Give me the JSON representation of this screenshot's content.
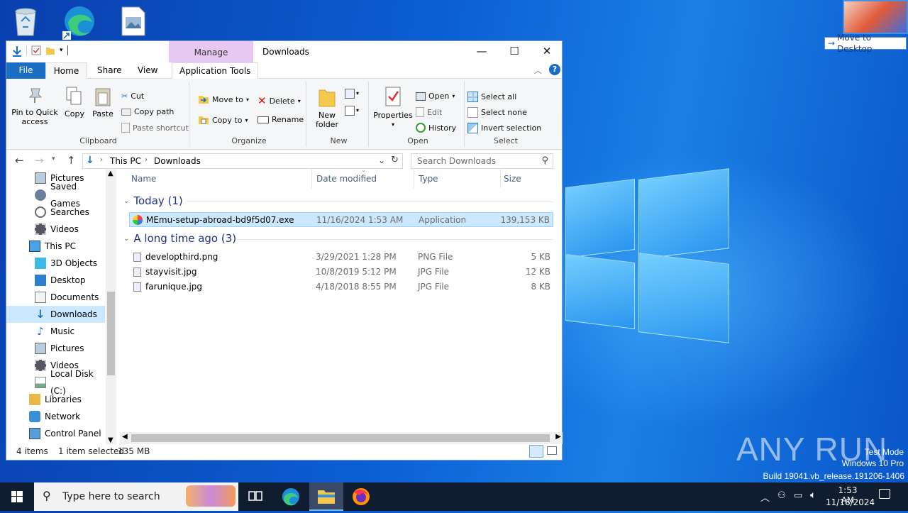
{
  "desktop": {
    "move_to_desktop": "Move to Desktop",
    "icons": [
      "recycle-bin-icon",
      "edge-shortcut-icon",
      "image-file-icon"
    ],
    "watermark": {
      "brand": "ANY RUN",
      "line1": "Test Mode",
      "line2": "Windows 10 Pro",
      "line3": "Build 19041.vb_release.191206-1406"
    }
  },
  "explorer": {
    "title": "Downloads",
    "context_tab": "Manage",
    "tabs": {
      "file": "File",
      "home": "Home",
      "share": "Share",
      "view": "View",
      "app_tools": "Application Tools"
    },
    "ribbon": {
      "clipboard": {
        "label": "Clipboard",
        "pin": "Pin to Quick access",
        "copy": "Copy",
        "paste": "Paste",
        "cut": "Cut",
        "copy_path": "Copy path",
        "paste_shortcut": "Paste shortcut"
      },
      "organize": {
        "label": "Organize",
        "move_to": "Move to",
        "copy_to": "Copy to",
        "delete": "Delete",
        "rename": "Rename"
      },
      "new": {
        "label": "New",
        "new_folder": "New folder"
      },
      "open": {
        "label": "Open",
        "properties": "Properties",
        "open": "Open",
        "edit": "Edit",
        "history": "History"
      },
      "select": {
        "label": "Select",
        "select_all": "Select all",
        "select_none": "Select none",
        "invert": "Invert selection"
      }
    },
    "address": {
      "crumb1": "This PC",
      "crumb2": "Downloads",
      "search_placeholder": "Search Downloads"
    },
    "nav": [
      "Pictures",
      "Saved Games",
      "Searches",
      "Videos",
      "This PC",
      "3D Objects",
      "Desktop",
      "Documents",
      "Downloads",
      "Music",
      "Pictures",
      "Videos",
      "Local Disk (C:)",
      "Libraries",
      "Network",
      "Control Panel"
    ],
    "columns": {
      "name": "Name",
      "date": "Date modified",
      "type": "Type",
      "size": "Size"
    },
    "groups": {
      "today": "Today (1)",
      "old": "A long time ago (3)"
    },
    "files": [
      {
        "name": "MEmu-setup-abroad-bd9f5d07.exe",
        "date": "11/16/2024 1:53 AM",
        "type": "Application",
        "size": "139,153 KB"
      },
      {
        "name": "developthird.png",
        "date": "3/29/2021 1:28 PM",
        "type": "PNG File",
        "size": "5 KB"
      },
      {
        "name": "stayvisit.jpg",
        "date": "10/8/2019 5:12 PM",
        "type": "JPG File",
        "size": "12 KB"
      },
      {
        "name": "farunique.jpg",
        "date": "4/18/2018 8:55 PM",
        "type": "JPG File",
        "size": "8 KB"
      }
    ],
    "status": {
      "items": "4 items",
      "selected": "1 item selected",
      "size": "135 MB"
    }
  },
  "taskbar": {
    "search_placeholder": "Type here to search",
    "time": "1:53 AM",
    "date": "11/16/2024"
  }
}
